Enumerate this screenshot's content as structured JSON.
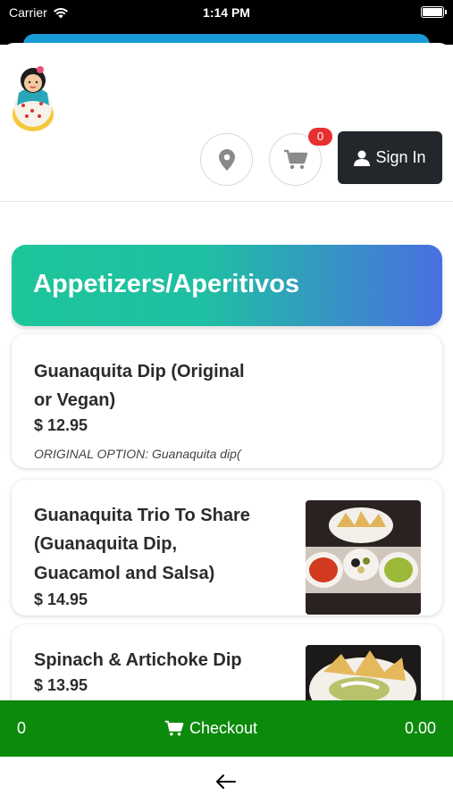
{
  "status_bar": {
    "carrier": "Carrier",
    "time": "1:14 PM"
  },
  "header": {
    "cart_count": "0",
    "sign_in_label": "Sign In"
  },
  "category": {
    "title": "Appetizers/Aperitivos"
  },
  "items": [
    {
      "name_line1": "Guanaquita Dip (Original",
      "name_line2": "or Vegan)",
      "price": "$ 12.95",
      "description": "ORIGINAL OPTION: Guanaquita dip("
    },
    {
      "name_line1": "Guanaquita Trio To Share",
      "name_line2": "(Guanaquita Dip,",
      "name_line3": "Guacamol and Salsa)",
      "price": "$ 14.95"
    },
    {
      "name_line1": "Spinach & Artichoke Dip",
      "price": "$ 13.95"
    }
  ],
  "checkout": {
    "count": "0",
    "label": "Checkout",
    "total": "0.00"
  },
  "icons": [
    "wifi-icon",
    "battery-icon",
    "location-pin-icon",
    "cart-icon",
    "user-icon",
    "back-arrow-icon"
  ],
  "colors": {
    "checkout_green": "#0c8a0c",
    "signin_dark": "#23272b",
    "badge_red": "#e63030"
  }
}
